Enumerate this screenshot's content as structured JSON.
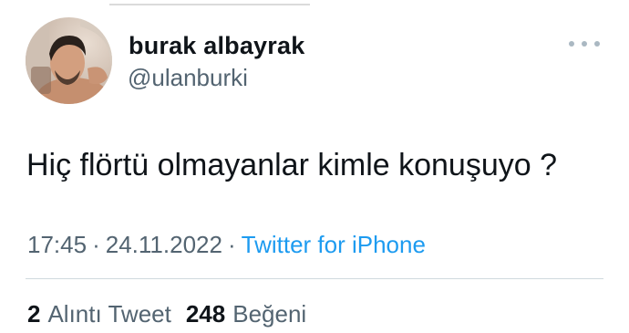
{
  "user": {
    "display_name": "burak albayrak",
    "handle": "@ulanburki",
    "avatar": "profile-photo"
  },
  "tweet": {
    "text": "Hiç flörtü olmayanlar kimle konuşuyo ?",
    "time": "17:45",
    "separator": "·",
    "date": "24.11.2022",
    "source": "Twitter for iPhone"
  },
  "stats": {
    "quote_count": "2",
    "quote_label": "Alıntı Tweet",
    "like_count": "248",
    "like_label": "Beğeni"
  },
  "icons": {
    "more": "more-horizontal-icon"
  },
  "colors": {
    "text": "#0f1419",
    "secondary": "#536471",
    "link": "#1d9bf0",
    "divider": "#cfd9de"
  }
}
